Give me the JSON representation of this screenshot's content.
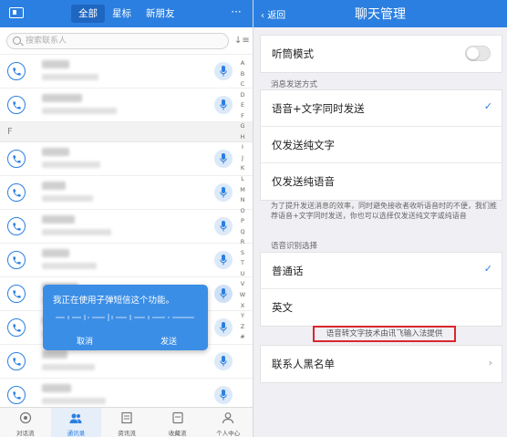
{
  "left": {
    "header": {
      "tabs": [
        "全部",
        "星标",
        "新朋友"
      ],
      "active_tab": 0,
      "more_label": "···"
    },
    "search": {
      "placeholder": "搜索联系人"
    },
    "section_letter": "F",
    "index_letters": [
      "A",
      "B",
      "C",
      "D",
      "E",
      "F",
      "G",
      "H",
      "I",
      "J",
      "K",
      "L",
      "M",
      "N",
      "O",
      "P",
      "Q",
      "R",
      "S",
      "T",
      "U",
      "V",
      "W",
      "X",
      "Y",
      "Z",
      "#"
    ],
    "popup": {
      "message": "我正在使用子弹短信这个功能。",
      "cancel_label": "取消",
      "send_label": "发送"
    },
    "tabbar": {
      "items": [
        "对话流",
        "通讯录",
        "资讯流",
        "收藏流",
        "个人中心"
      ],
      "active": 1
    }
  },
  "right": {
    "header": {
      "back_label": "返回",
      "title": "聊天管理"
    },
    "earpiece": {
      "label": "听筒模式",
      "enabled": false
    },
    "send_mode": {
      "section_label": "消息发送方式",
      "options": [
        "语音+文字同时发送",
        "仅发送纯文字",
        "仅发送纯语音"
      ],
      "selected": 0,
      "note": "为了提升发送消息的效率，同时避免接收者收听语音时的不便，我们推荐语音+文字同时发送，你也可以选择仅发送纯文字或纯语音"
    },
    "recognition": {
      "section_label": "语音识别选择",
      "options": [
        "普通话",
        "英文"
      ],
      "selected": 0
    },
    "credit": "语音转文字技术由讯飞输入法提供",
    "blacklist_label": "联系人黑名单"
  },
  "colors": {
    "accent": "#2b7fe0",
    "highlight_border": "#d8282e",
    "popup_bg": "#3b8ee6"
  }
}
